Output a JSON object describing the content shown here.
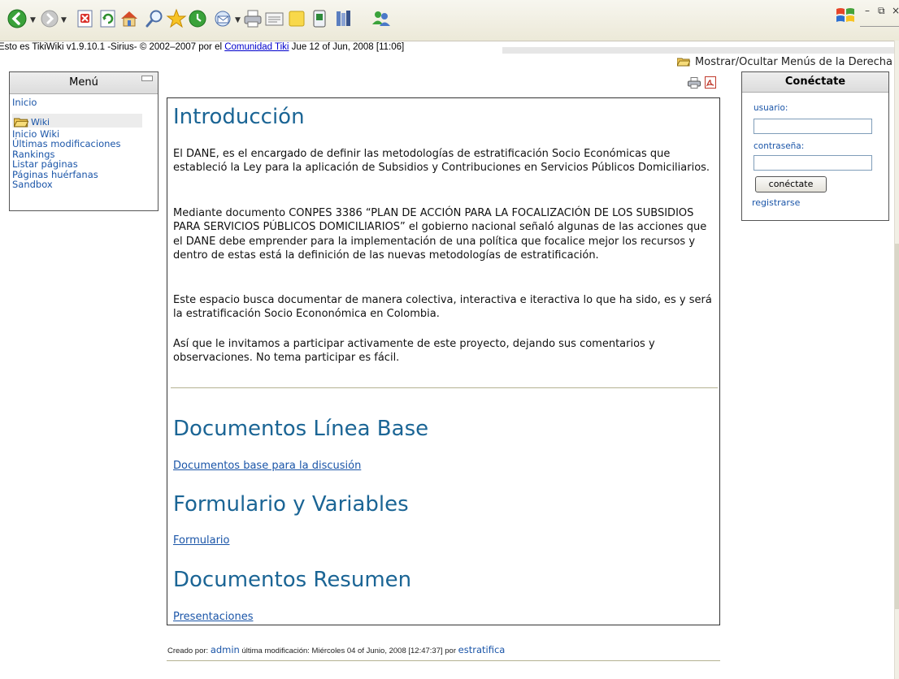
{
  "toolbar": {
    "buttons": [
      "back-icon",
      "forward-icon",
      "stop-icon",
      "refresh-icon",
      "home-icon",
      "search-icon",
      "favorites-icon",
      "history-icon",
      "mail-icon",
      "print-icon",
      "edit-icon",
      "notes-icon",
      "messenger-icon",
      "research-icon",
      "contacts-icon"
    ],
    "colors": {
      "back": "#3aa23a",
      "accent": "#1b6595",
      "link": "#1a55a8"
    }
  },
  "statusline": {
    "prefix": "Esto es TikiWiki v1.9.10.1 -Sirius- © 2002–2007 por el ",
    "link": "Comunidad Tiki",
    "suffix": " Jue 12 of Jun, 2008 [11:06]"
  },
  "toggle_right": {
    "label": "Mostrar/Ocultar Menús de la Derecha"
  },
  "menu": {
    "title": "Menú",
    "items_top": [
      "Inicio"
    ],
    "wiki_section": "Wiki",
    "items": [
      "Inicio Wiki",
      "Últimas modificaciones",
      "Rankings",
      "Listar páginas",
      "Páginas huérfanas",
      "Sandbox"
    ]
  },
  "login": {
    "title": "Conéctate",
    "user_label": "usuario:",
    "password_label": "contraseña:",
    "user_value": "",
    "password_value": "",
    "button": "conéctate",
    "register": "registrarse"
  },
  "content": {
    "h1": "Introducción",
    "p1": "El DANE, es el encargado de definir las metodologías de estratificación Socio Económicas que estableció la Ley para la aplicación de Subsidios y Contribuciones en Servicios Públicos Domiciliarios.",
    "p2": "Mediante documento CONPES 3386 “PLAN DE ACCIÓN PARA LA FOCALIZACIÓN DE LOS SUBSIDIOS PARA SERVICIOS PÚBLICOS DOMICILIARIOS” el gobierno nacional señaló algunas de las acciones que el DANE debe emprender para la implementación de una política que focalice mejor los recursos y dentro de estas está la definición de las nuevas metodologías de estratificación.",
    "p3": "Este espacio busca documentar de manera colectiva, interactiva e iteractiva lo que ha sido, es y será la estratificación Socio Econonómica en Colombia.",
    "p4": "Así que le invitamos a participar activamente de este proyecto, dejando sus comentarios y observaciones. No tema participar es fácil.",
    "h2": "Documentos Línea Base",
    "link1": "Documentos base para la discusión",
    "h3": "Formulario y Variables",
    "link2": "Formulario",
    "h4": "Documentos Resumen",
    "link3": "Presentaciones"
  },
  "footer": {
    "created_by": "Creado por: ",
    "author": "admin",
    "modified": " última modificación: Miércoles 04 of Junio, 2008 [12:47:37] por ",
    "modifier": "estratifica"
  }
}
